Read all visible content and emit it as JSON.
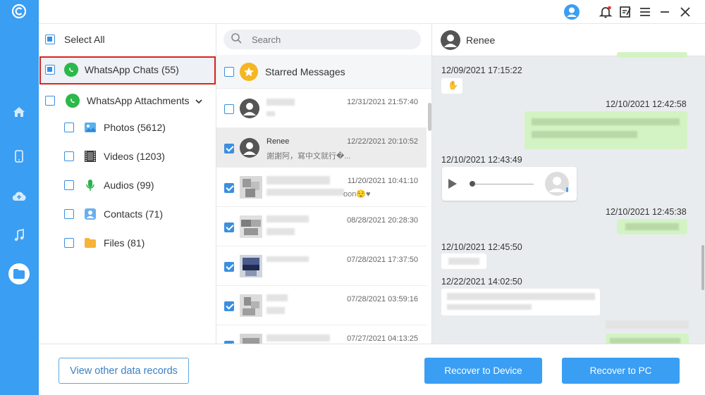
{
  "categories": {
    "select_all": "Select All",
    "whatsapp_chats": "WhatsApp Chats (55)",
    "whatsapp_attachments": "WhatsApp Attachments",
    "items": [
      {
        "label": "Photos (5612)",
        "icon": "photos-icon"
      },
      {
        "label": "Videos (1203)",
        "icon": "videos-icon"
      },
      {
        "label": "Audios (99)",
        "icon": "audios-icon"
      },
      {
        "label": "Contacts (71)",
        "icon": "contacts-icon"
      },
      {
        "label": "Files (81)",
        "icon": "files-icon"
      }
    ]
  },
  "chat_list": {
    "search_placeholder": "Search",
    "starred": "Starred Messages",
    "chats": [
      {
        "name": "",
        "preview": "",
        "time": "12/31/2021 21:57:40",
        "checked": false
      },
      {
        "name": "Renee",
        "preview": "謝謝阿，寫中文就行�...",
        "time": "12/22/2021 20:10:52",
        "checked": true
      },
      {
        "name": "",
        "preview": "oon😌♥",
        "time": "11/20/2021 10:41:10",
        "checked": true
      },
      {
        "name": "",
        "preview": "",
        "time": "08/28/2021 20:28:30",
        "checked": true
      },
      {
        "name": "",
        "preview": "",
        "time": "07/28/2021 17:37:50",
        "checked": true
      },
      {
        "name": "",
        "preview": "",
        "time": "07/28/2021 03:59:16",
        "checked": true
      },
      {
        "name": "",
        "preview": "",
        "time": "07/27/2021 04:13:25",
        "checked": true
      }
    ]
  },
  "conversation": {
    "contact_name": "Renee",
    "timestamps": [
      "12/09/2021 17:15:22",
      "12/10/2021 12:42:58",
      "12/10/2021 12:43:49",
      "12/10/2021 12:45:38",
      "12/10/2021 12:45:50",
      "12/22/2021 14:02:50"
    ]
  },
  "footer": {
    "view_other": "View other data records",
    "recover_device": "Recover to Device",
    "recover_pc": "Recover to PC"
  },
  "colors": {
    "accent": "#3a9ef3",
    "highlight_border": "#d9261c",
    "whatsapp_green": "#2ab94a",
    "outgoing_bubble": "#d4f3c4"
  }
}
